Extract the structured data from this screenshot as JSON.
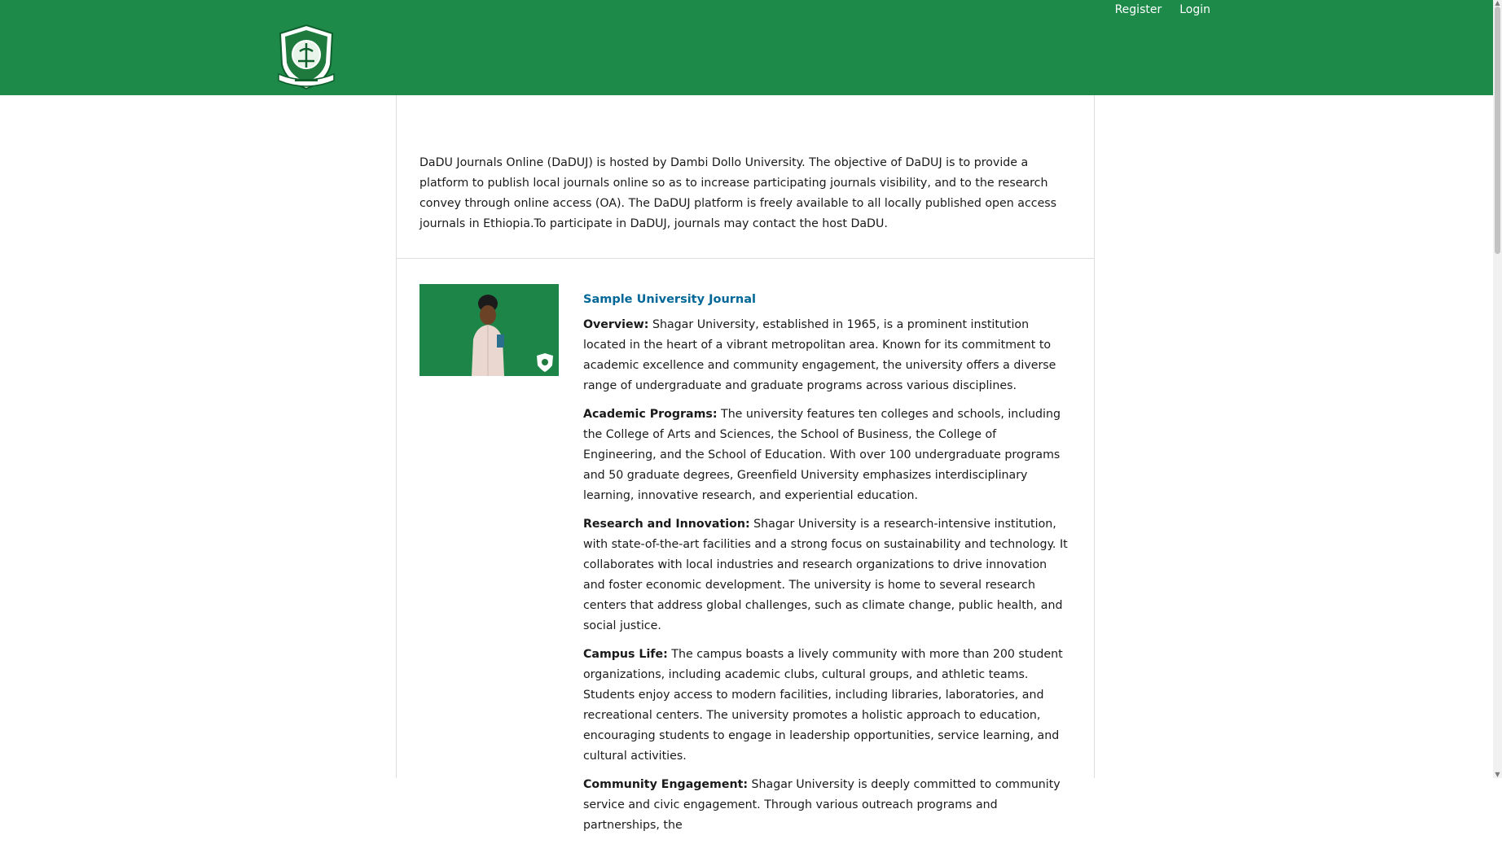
{
  "header": {
    "logo_icon": "university-crest-logo",
    "background_color": "#1d8a4a",
    "user_nav": {
      "register_label": "Register",
      "login_label": "Login"
    }
  },
  "about": {
    "text": "DaDU Journals Online (DaDUJ) is hosted by Dambi Dollo University. The objective of DaDUJ is to provide a platform to publish local journals online so as to increase participating journals visibility, and to the research convey through online access (OA). The DaDUJ platform is freely available to all locally published open access journals in Ethiopia.To participate in DaDUJ, journals may contact the host DaDU."
  },
  "journal": {
    "thumbnail_alt": "student-holding-book-photo",
    "title": "Sample University Journal",
    "sections": [
      {
        "label": "Overview:",
        "text": " Shagar University, established in 1965, is a prominent institution located in the heart of a vibrant metropolitan area. Known for its commitment to academic excellence and community engagement, the university offers a diverse range of undergraduate and graduate programs across various disciplines."
      },
      {
        "label": "Academic Programs:",
        "text": " The university features ten colleges and schools, including the College of Arts and Sciences, the School of Business, the College of Engineering, and the School of Education. With over 100 undergraduate programs and 50 graduate degrees, Greenfield University emphasizes interdisciplinary learning, innovative research, and experiential education."
      },
      {
        "label": "Research and Innovation:",
        "text": " Shagar University is a research-intensive institution, with state-of-the-art facilities and a strong focus on sustainability and technology. It collaborates with local industries and research organizations to drive innovation and foster economic development. The university is home to several research centers that address global challenges, such as climate change, public health, and social justice."
      },
      {
        "label": "Campus Life:",
        "text": " The campus boasts a lively community with more than 200 student organizations, including academic clubs, cultural groups, and athletic teams. Students enjoy access to modern facilities, including libraries, laboratories, and recreational centers. The university promotes a holistic approach to education, encouraging students to engage in leadership opportunities, service learning, and cultural activities."
      },
      {
        "label": "Community Engagement:",
        "text": "  Shagar University is deeply committed to community service and civic engagement. Through various outreach programs and partnerships, the"
      }
    ]
  },
  "colors": {
    "link": "#006798",
    "border": "#dddddd"
  }
}
